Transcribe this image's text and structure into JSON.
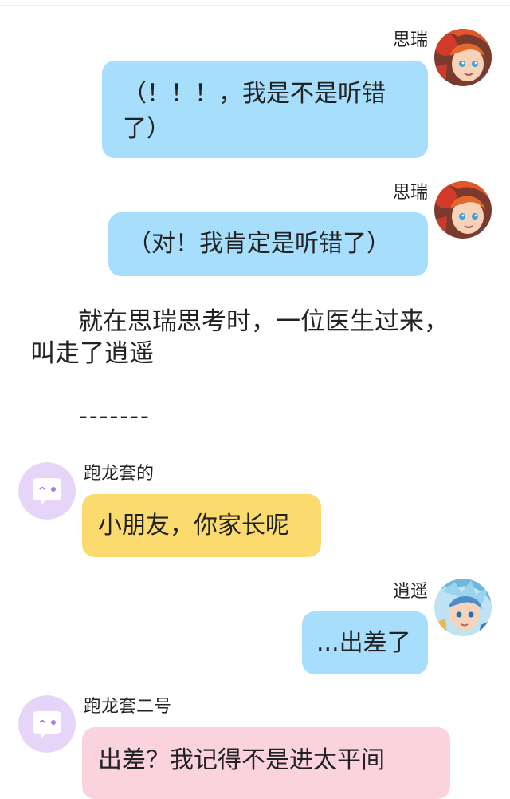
{
  "messages": [
    {
      "sender": "思瑞",
      "text": "（！！！，我是不是听错了）"
    },
    {
      "sender": "思瑞",
      "text": "（对！我肯定是听错了）"
    },
    {
      "sender": "跑龙套的",
      "text": "小朋友，你家长呢"
    },
    {
      "sender": "逍遥",
      "text": "...出差了"
    },
    {
      "sender": "跑龙套二号",
      "text": "出差？我记得不是进太平间"
    }
  ],
  "narration": {
    "line1": "就在思瑞思考时，一位医生过来，",
    "line2": "叫走了逍遥",
    "divider": "-------"
  },
  "colors": {
    "blue_bubble": "#a7defb",
    "yellow_bubble": "#fbdb6e",
    "pink_bubble": "#fbd3df",
    "npc_avatar_bg": "#e7d5f9",
    "npc_avatar_accent": "#b07be6"
  },
  "icons": {
    "npc_avatar": "speech-bubble-avatar-icon",
    "sirui_avatar": "cartoon-hero-avatar",
    "xiaoyao_avatar": "cartoon-hero-avatar-blue"
  }
}
